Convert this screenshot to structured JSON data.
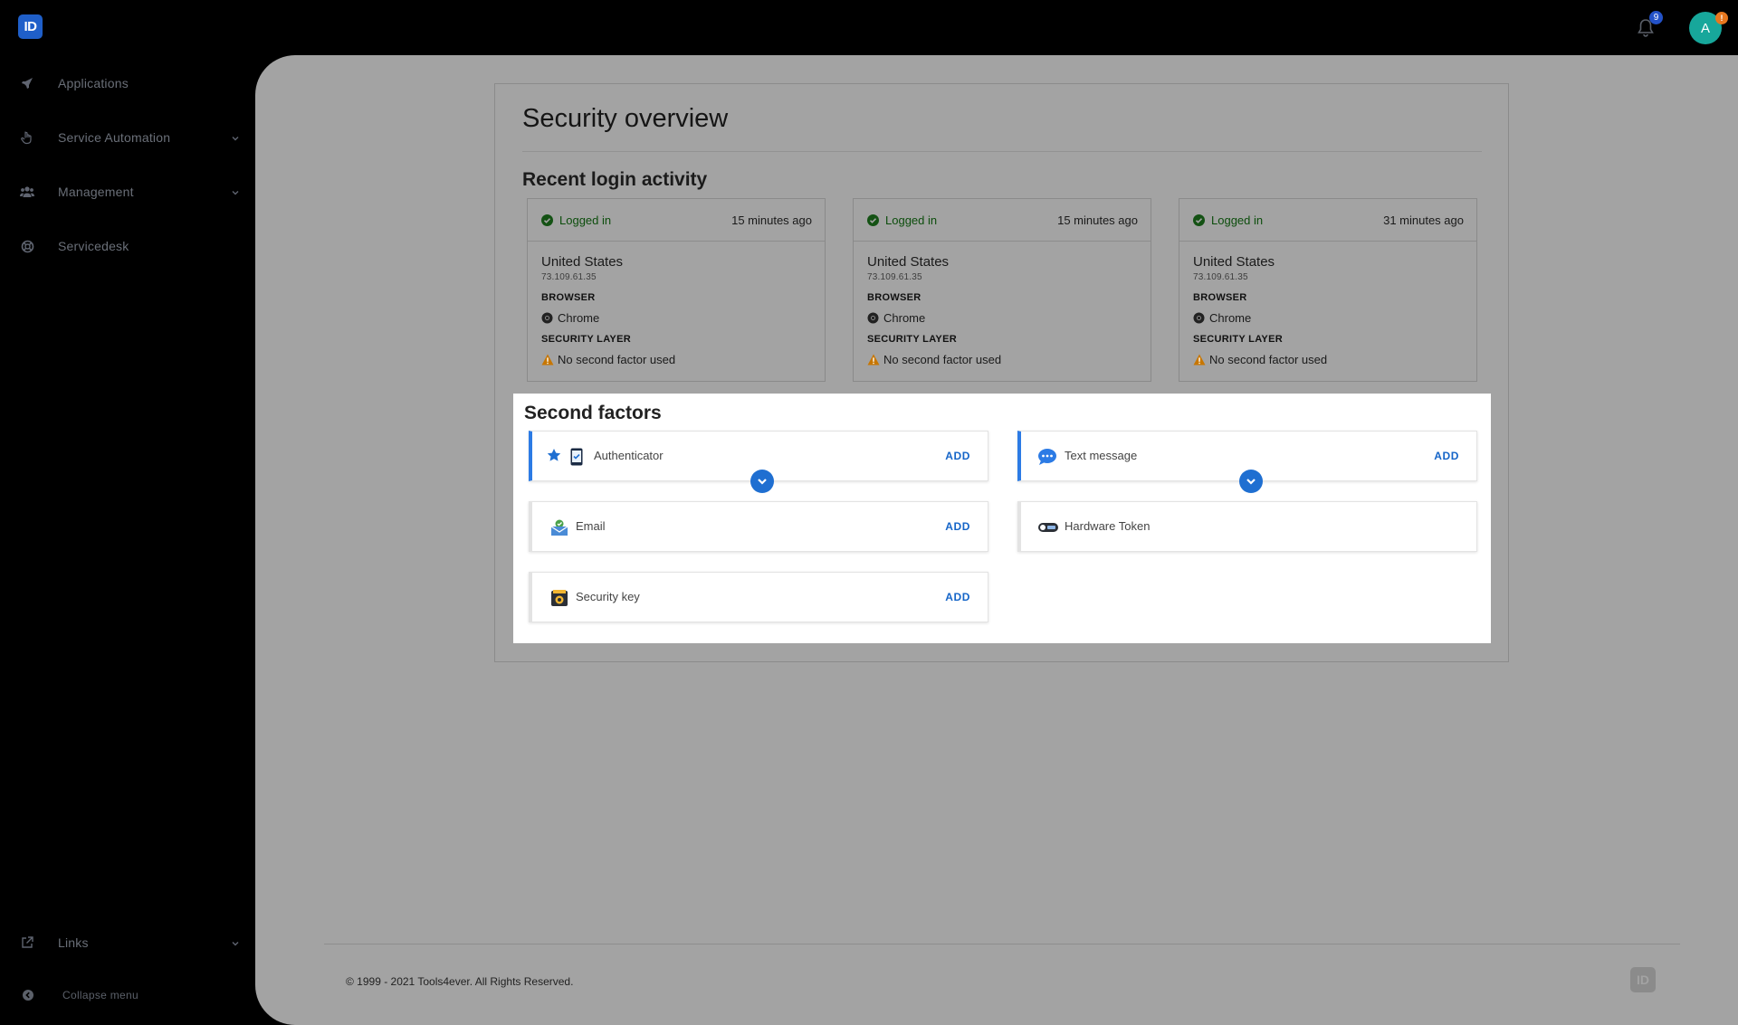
{
  "header": {
    "logo_text": "ID",
    "notifications_count": "9",
    "avatar_initial": "A",
    "avatar_badge": "!"
  },
  "sidebar": {
    "items": [
      {
        "label": "Applications",
        "icon": "rocket-icon"
      },
      {
        "label": "Service Automation",
        "icon": "hand-pointer-icon"
      },
      {
        "label": "Management",
        "icon": "users-icon"
      },
      {
        "label": "Servicedesk",
        "icon": "lifebuoy-icon"
      }
    ],
    "links_label": "Links",
    "collapse_label": "Collapse menu"
  },
  "main": {
    "title": "Security overview",
    "recent_title": "Recent login activity",
    "logins": [
      {
        "status": "Logged in",
        "time": "15 minutes ago",
        "country": "United States",
        "ip": "73.109.61.35",
        "browser_label": "BROWSER",
        "browser": "Chrome",
        "security_label": "SECURITY LAYER",
        "security": "No second factor used"
      },
      {
        "status": "Logged in",
        "time": "15 minutes ago",
        "country": "United States",
        "ip": "73.109.61.35",
        "browser_label": "BROWSER",
        "browser": "Chrome",
        "security_label": "SECURITY LAYER",
        "security": "No second factor used"
      },
      {
        "status": "Logged in",
        "time": "31 minutes ago",
        "country": "United States",
        "ip": "73.109.61.35",
        "browser_label": "BROWSER",
        "browser": "Chrome",
        "security_label": "SECURITY LAYER",
        "security": "No second factor used"
      }
    ],
    "second_factors_title": "Second factors",
    "factors": [
      {
        "label": "Authenticator",
        "action": "ADD"
      },
      {
        "label": "Text message",
        "action": "ADD"
      },
      {
        "label": "Email",
        "action": "ADD"
      },
      {
        "label": "Hardware Token",
        "action": ""
      },
      {
        "label": "Security key",
        "action": "ADD"
      }
    ]
  },
  "footer": {
    "copyright": "© 1999 - 2021 Tools4ever. All Rights Reserved.",
    "logo_text": "ID"
  },
  "colors": {
    "accent": "#1f6fd1",
    "success": "#0c4d0c",
    "warning": "#e08a00",
    "avatar": "#17a79b"
  }
}
